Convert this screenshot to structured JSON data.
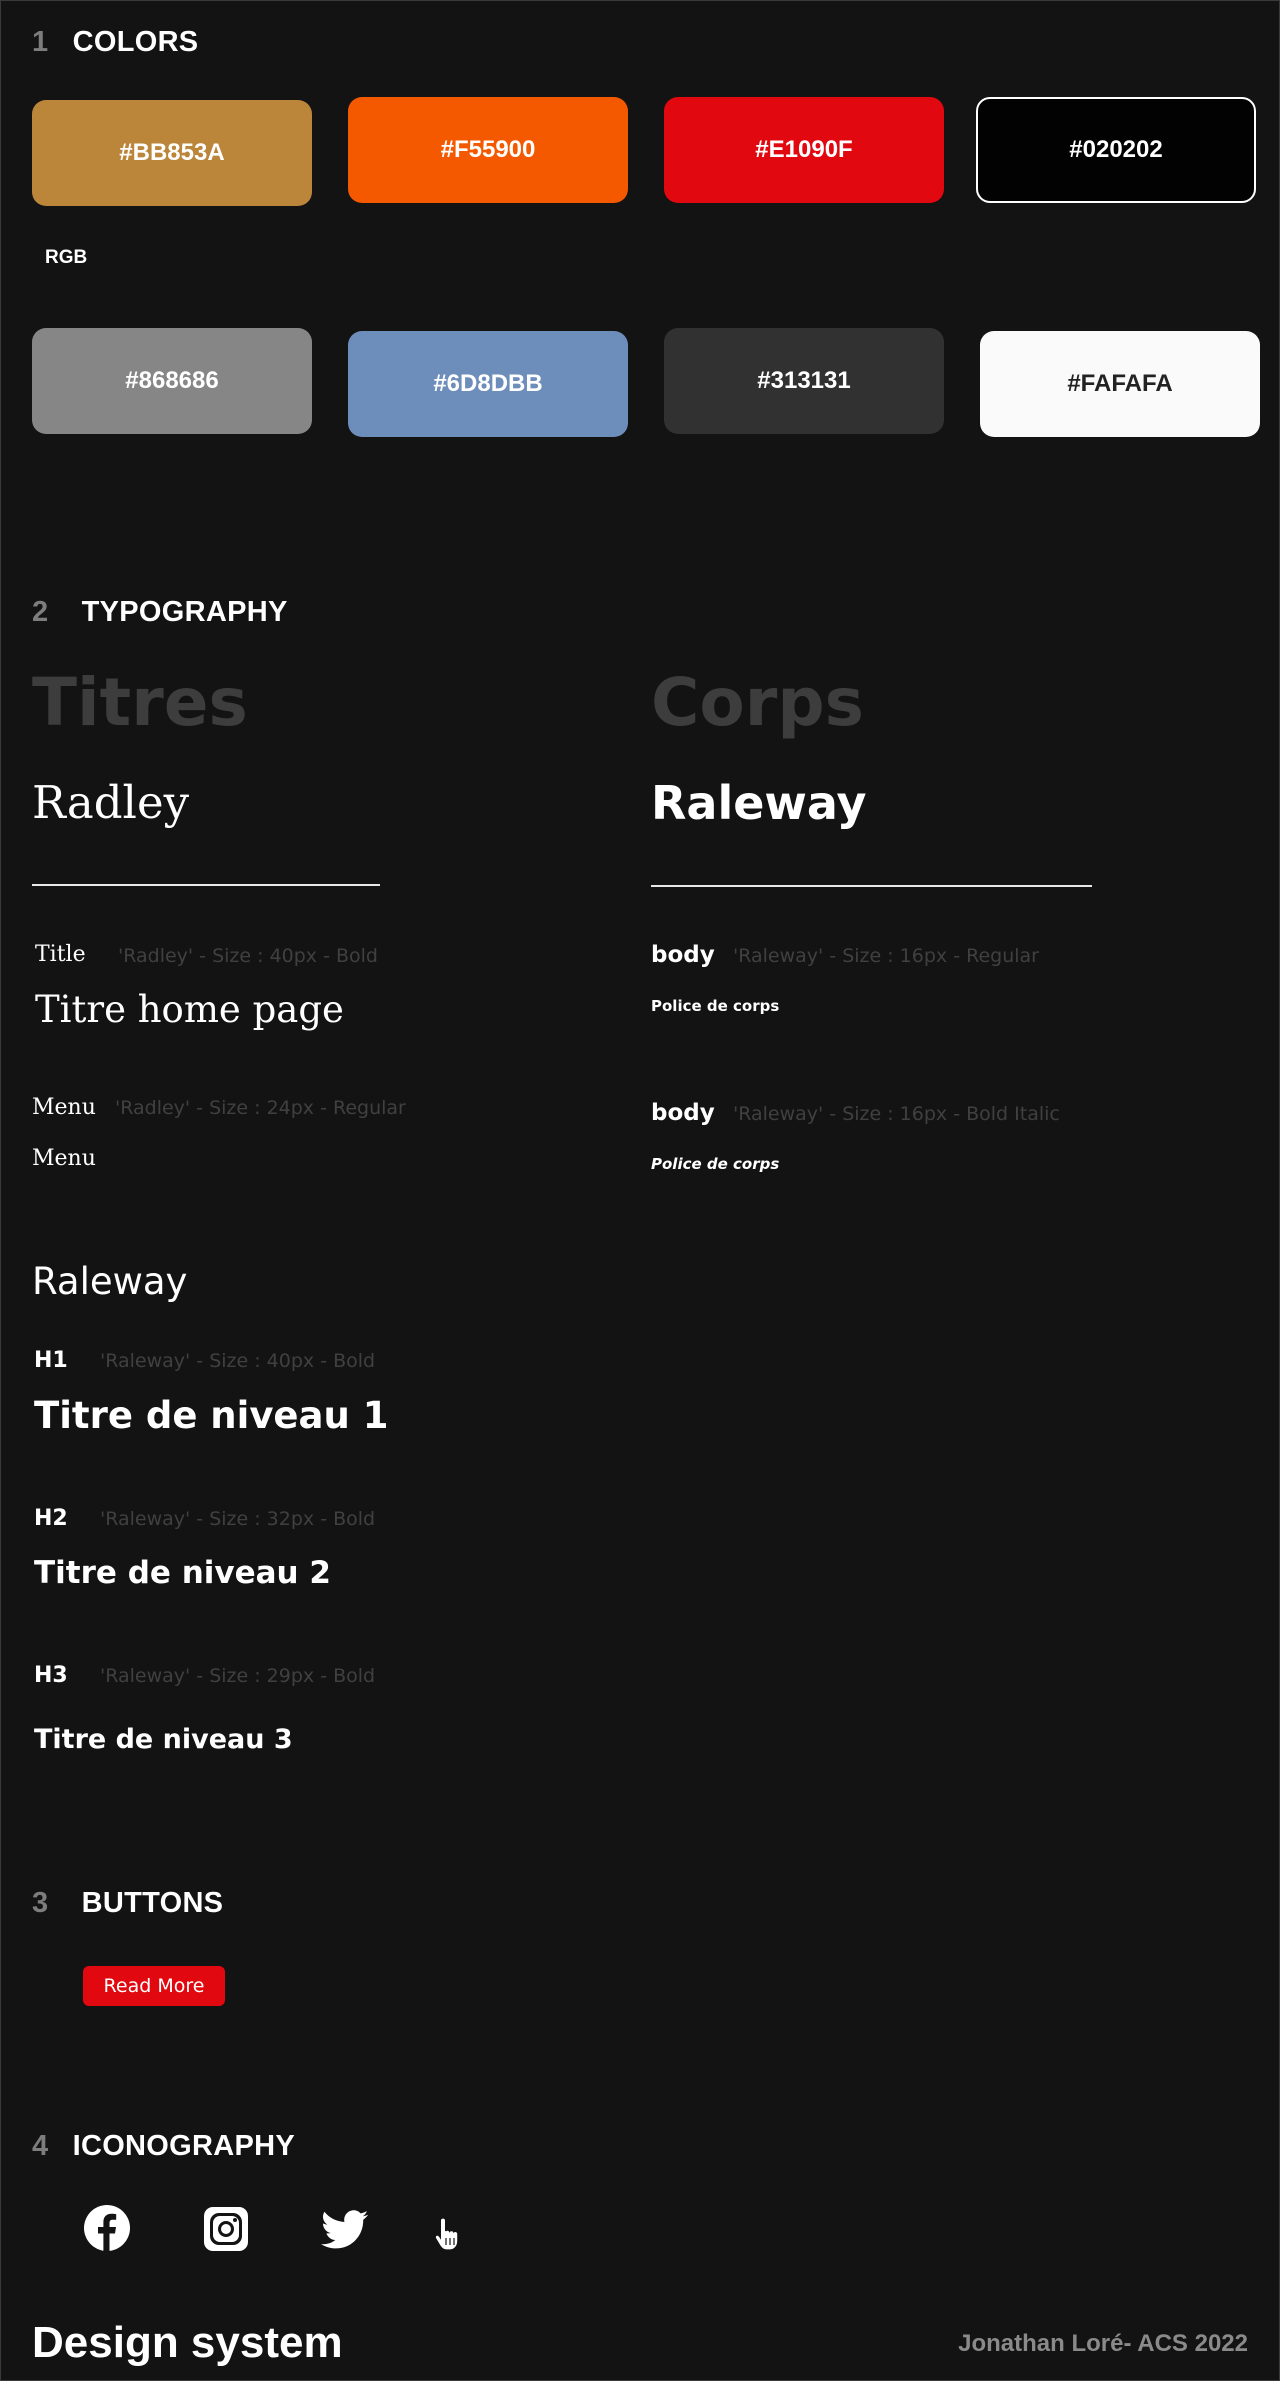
{
  "sections": {
    "colors": {
      "num": "1",
      "title": "COLORS"
    },
    "typography": {
      "num": "2",
      "title": "TYPOGRAPHY"
    },
    "buttons": {
      "num": "3",
      "title": "BUTTONS"
    },
    "iconography": {
      "num": "4",
      "title": "ICONOGRAPHY"
    }
  },
  "colors": {
    "row1": [
      {
        "label": "#BB853A",
        "hex": "#BB853A"
      },
      {
        "label": "#F55900",
        "hex": "#F55900"
      },
      {
        "label": "#E1090F",
        "hex": "#E1090F"
      },
      {
        "label": "#020202",
        "hex": "#020202"
      }
    ],
    "rgb_label": "RGB",
    "row2": [
      {
        "label": "#868686",
        "hex": "#868686"
      },
      {
        "label": "#6D8DBB",
        "hex": "#6D8DBB"
      },
      {
        "label": "#313131",
        "hex": "#313131"
      },
      {
        "label": "#FAFAFA",
        "hex": "#FAFAFA"
      }
    ]
  },
  "typography": {
    "titles_heading": "Titres",
    "titles_font": "Radley",
    "body_heading": "Corps",
    "body_font": "Raleway",
    "title_style": {
      "tag": "Title",
      "spec": "'Radley' - Size : 40px - Bold",
      "sample": "Titre home page"
    },
    "menu_style": {
      "tag": "Menu",
      "spec": "'Radley' - Size : 24px - Regular",
      "sample": "Menu"
    },
    "raleway_heading": "Raleway",
    "h1": {
      "tag": "H1",
      "spec": "'Raleway' - Size : 40px - Bold",
      "sample": "Titre de niveau 1"
    },
    "h2": {
      "tag": "H2",
      "spec": "'Raleway' -  Size : 32px - Bold",
      "sample": "Titre de niveau 2"
    },
    "h3": {
      "tag": "H3",
      "spec": "'Raleway' -  Size : 29px - Bold",
      "sample": "Titre de niveau 3"
    },
    "body_regular": {
      "tag": "body",
      "spec": "'Raleway' - Size : 16px - Regular",
      "sample": "Police de corps"
    },
    "body_bold_italic": {
      "tag": "body",
      "spec": "'Raleway' - Size : 16px - Bold Italic",
      "sample": "Police de corps"
    }
  },
  "buttons": {
    "read_more": "Read More"
  },
  "icons": [
    "facebook-icon",
    "instagram-icon",
    "twitter-icon",
    "hand-pointer-icon"
  ],
  "footer": {
    "title": "Design system",
    "credit": "Jonathan Loré- ACS 2022"
  }
}
